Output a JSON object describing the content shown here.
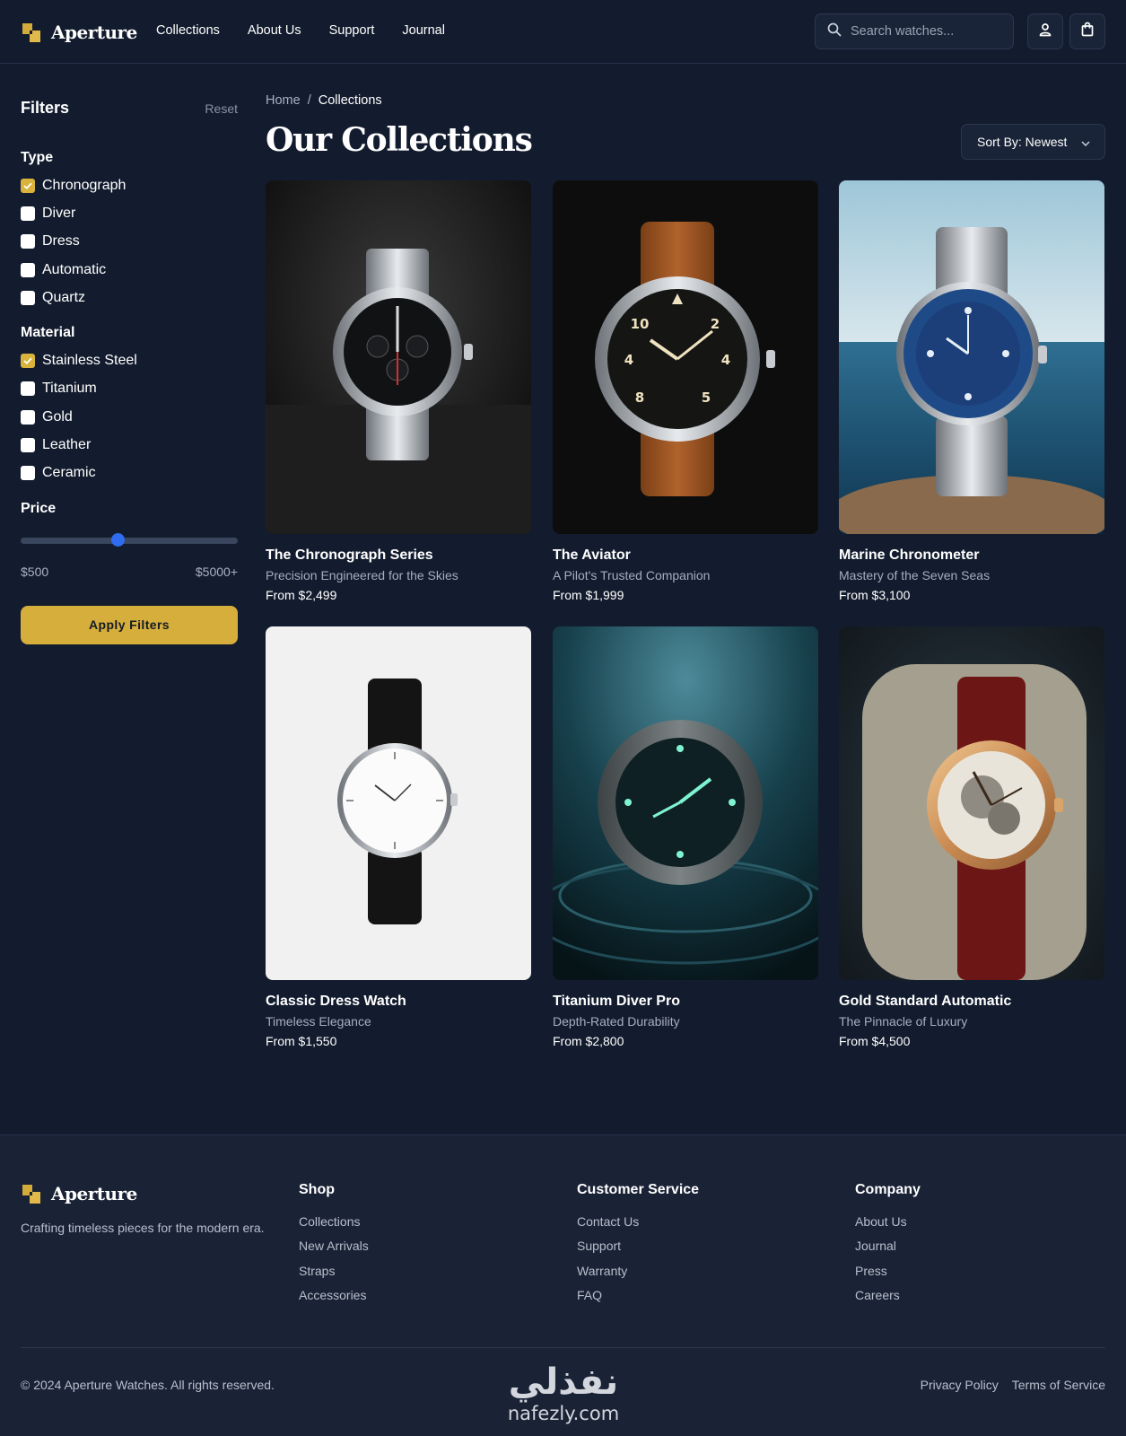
{
  "brand": {
    "name": "Aperture",
    "accent": "#d6ae3c"
  },
  "nav": {
    "links": [
      "Collections",
      "About Us",
      "Support",
      "Journal"
    ],
    "search_placeholder": "Search watches...",
    "icons": [
      "search-icon",
      "user-icon",
      "shopping-bag-icon"
    ]
  },
  "filters": {
    "title": "Filters",
    "reset_label": "Reset",
    "type": {
      "title": "Type",
      "options": [
        {
          "label": "Chronograph",
          "checked": true
        },
        {
          "label": "Diver",
          "checked": false
        },
        {
          "label": "Dress",
          "checked": false
        },
        {
          "label": "Automatic",
          "checked": false
        },
        {
          "label": "Quartz",
          "checked": false
        }
      ]
    },
    "material": {
      "title": "Material",
      "options": [
        {
          "label": "Stainless Steel",
          "checked": true
        },
        {
          "label": "Titanium",
          "checked": false
        },
        {
          "label": "Gold",
          "checked": false
        },
        {
          "label": "Leather",
          "checked": false
        },
        {
          "label": "Ceramic",
          "checked": false
        }
      ]
    },
    "price": {
      "title": "Price",
      "min_label": "$500",
      "max_label": "$5000+",
      "slider_fraction": 0.45
    },
    "apply_label": "Apply Filters"
  },
  "breadcrumb": {
    "home": "Home",
    "separator": "/",
    "current": "Collections"
  },
  "page_title": "Our Collections",
  "sort": {
    "label": "Sort By: Newest"
  },
  "products": [
    {
      "name": "The Chronograph Series",
      "tagline": "Precision Engineered for the Skies",
      "price": "From $2,499"
    },
    {
      "name": "The Aviator",
      "tagline": "A Pilot's Trusted Companion",
      "price": "From $1,999"
    },
    {
      "name": "Marine Chronometer",
      "tagline": "Mastery of the Seven Seas",
      "price": "From $3,100"
    },
    {
      "name": "Classic Dress Watch",
      "tagline": "Timeless Elegance",
      "price": "From $1,550"
    },
    {
      "name": "Titanium Diver Pro",
      "tagline": "Depth-Rated Durability",
      "price": "From $2,800"
    },
    {
      "name": "Gold Standard Automatic",
      "tagline": "The Pinnacle of Luxury",
      "price": "From $4,500"
    }
  ],
  "footer": {
    "brand": "Aperture",
    "tagline": "Crafting timeless pieces for the modern era.",
    "columns": [
      {
        "title": "Shop",
        "links": [
          "Collections",
          "New Arrivals",
          "Straps",
          "Accessories"
        ]
      },
      {
        "title": "Customer Service",
        "links": [
          "Contact Us",
          "Support",
          "Warranty",
          "FAQ"
        ]
      },
      {
        "title": "Company",
        "links": [
          "About Us",
          "Journal",
          "Press",
          "Careers"
        ]
      }
    ],
    "copyright": "© 2024 Aperture Watches. All rights reserved.",
    "legal": [
      "Privacy Policy",
      "Terms of Service"
    ]
  },
  "watermark": {
    "arabic": "نفذلي",
    "latin": "nafezly.com"
  }
}
